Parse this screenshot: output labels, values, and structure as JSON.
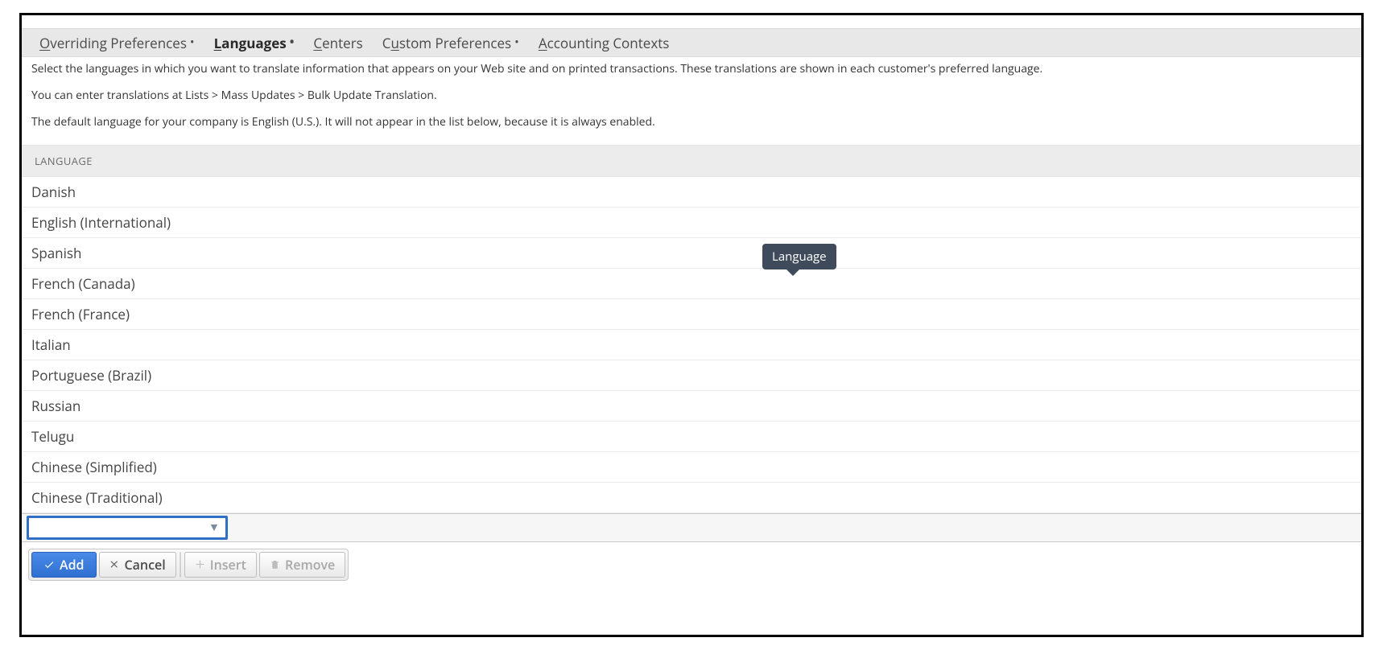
{
  "tabs": [
    {
      "label_pre": "O",
      "label_mid": "verriding Preferences",
      "has_bullet": true,
      "active": false
    },
    {
      "label_pre": "L",
      "label_mid": "anguages",
      "has_bullet": true,
      "active": true
    },
    {
      "label_pre": "C",
      "label_mid": "enters",
      "has_bullet": false,
      "active": false
    },
    {
      "label_pre": "C",
      "label_mid": "ustom Preferences",
      "has_bullet": true,
      "active": false,
      "underline_second": "u",
      "rest": "stom Preferences"
    },
    {
      "label_pre": "A",
      "label_mid": "ccounting Contexts",
      "has_bullet": false,
      "active": false
    }
  ],
  "intro": {
    "p1": "Select the languages in which you want to translate information that appears on your Web site and on printed transactions. These translations are shown in each customer's preferred language.",
    "p2": "You can enter translations at Lists > Mass Updates > Bulk Update Translation.",
    "p3": "The default language for your company is English (U.S.). It will not appear in the list below, because it is always enabled."
  },
  "table": {
    "header": "LANGUAGE",
    "rows": [
      "Danish",
      "English (International)",
      "Spanish",
      "French (Canada)",
      "French (France)",
      "Italian",
      "Portuguese (Brazil)",
      "Russian",
      "Telugu",
      "Chinese (Simplified)",
      "Chinese (Traditional)"
    ]
  },
  "combo": {
    "value": "",
    "placeholder": ""
  },
  "buttons": {
    "add": "Add",
    "cancel": "Cancel",
    "insert": "Insert",
    "remove": "Remove"
  },
  "tooltip": "Language"
}
